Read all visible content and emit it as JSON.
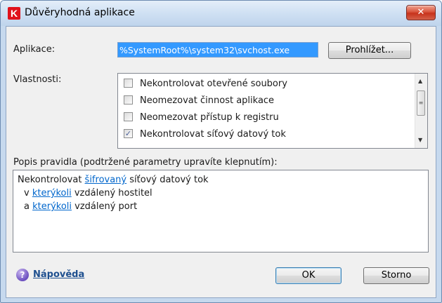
{
  "window": {
    "title": "Důvěryhodná aplikace",
    "app_icon_letter": "K",
    "close_glyph": "✕"
  },
  "application": {
    "label": "Aplikace:",
    "value": "%SystemRoot%\\system32\\svchost.exe",
    "browse_button": "Prohlížet..."
  },
  "properties": {
    "label": "Vlastnosti:",
    "items": [
      {
        "label": "Nekontrolovat otevřené soubory",
        "checked": false
      },
      {
        "label": "Neomezovat činnost aplikace",
        "checked": false
      },
      {
        "label": "Neomezovat přístup k registru",
        "checked": false
      },
      {
        "label": "Nekontrolovat síťový datový tok",
        "checked": true
      }
    ]
  },
  "description": {
    "label": "Popis pravidla (podtržené parametry upravíte klepnutím):",
    "line1": {
      "prefix": "Nekontrolovat ",
      "link": "šifrovaný",
      "suffix": " síťový datový tok"
    },
    "line2": {
      "prefix": "v ",
      "link": "kterýkoli",
      "suffix": " vzdálený hostitel"
    },
    "line3": {
      "prefix": "a ",
      "link": "kterýkoli",
      "suffix": " vzdálený port"
    }
  },
  "footer": {
    "help_link": "Nápověda",
    "ok_button": "OK",
    "cancel_button": "Storno"
  },
  "colors": {
    "selection": "#3399ff",
    "link": "#0066cc",
    "close_button": "#c7321b",
    "brand_red": "#e0121c"
  }
}
